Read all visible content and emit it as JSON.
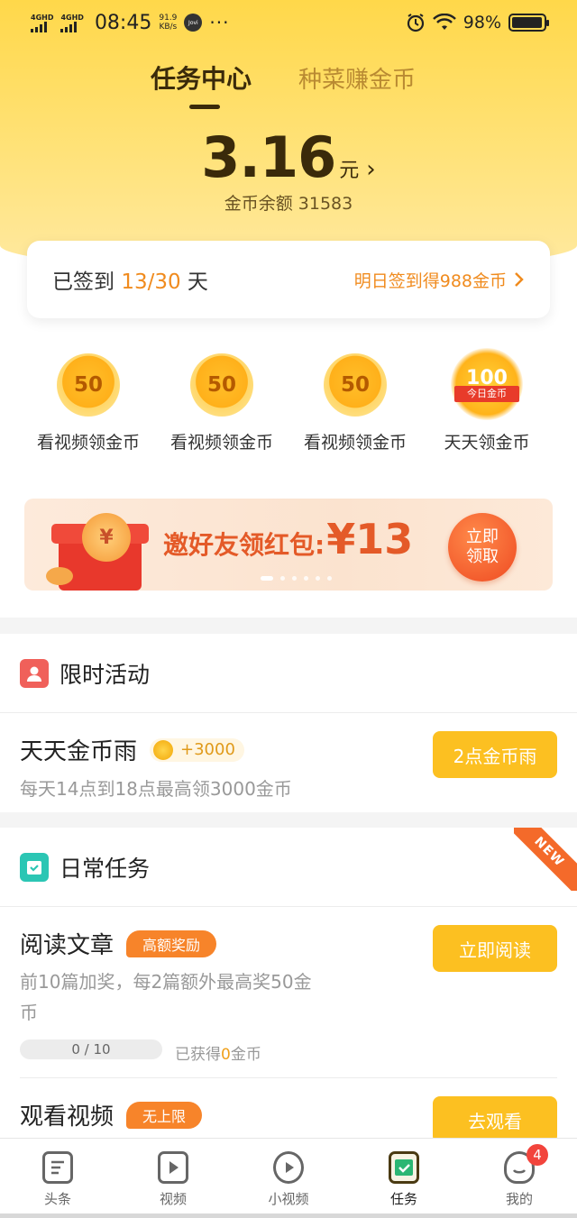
{
  "status_bar": {
    "sim1": "4GHD",
    "sim2": "4GHD",
    "time": "08:45",
    "speed_value": "91.9",
    "speed_unit": "KB/s",
    "app_icon_text": "Jovi",
    "more": "···",
    "battery": "98%"
  },
  "tabs": {
    "active": "任务中心",
    "other": "种菜赚金币"
  },
  "balance": {
    "amount": "3.16",
    "unit": "元",
    "coins_label": "金币余额 31583"
  },
  "signin": {
    "prefix": "已签到",
    "progress": "13/30",
    "suffix": "天",
    "tomorrow": "明日签到得988金币"
  },
  "quick_tasks": [
    {
      "coin": "50",
      "label": "看视频领金币"
    },
    {
      "coin": "50",
      "label": "看视频领金币"
    },
    {
      "coin": "50",
      "label": "看视频领金币"
    },
    {
      "coin": "100",
      "ribbon": "今日金币",
      "label": "天天领金币"
    }
  ],
  "banner": {
    "coin_symbol": "¥",
    "text": "邀好友领红包:",
    "amount": "¥13",
    "button_line1": "立即",
    "button_line2": "领取"
  },
  "limited": {
    "title": "限时活动",
    "item": {
      "title": "天天金币雨",
      "reward": "+3000",
      "desc": "每天14点到18点最高领3000金币",
      "button": "2点金币雨"
    }
  },
  "daily": {
    "title": "日常任务",
    "corner_tag": "NEW",
    "items": [
      {
        "title": "阅读文章",
        "badge": "高额奖励",
        "desc_line1": "前10篇加奖，每2篇额外最高奖50金",
        "desc_line2": "币",
        "progress": "0 / 10",
        "earned_prefix": "已获得",
        "earned_value": "0",
        "earned_suffix": "金币",
        "button": "立即阅读"
      },
      {
        "title": "观看视频",
        "badge": "无上限",
        "button": "去观看"
      }
    ]
  },
  "bottom_nav": {
    "items": [
      {
        "label": "头条",
        "icon": "news-icon"
      },
      {
        "label": "视频",
        "icon": "video-icon"
      },
      {
        "label": "小视频",
        "icon": "short-video-icon"
      },
      {
        "label": "任务",
        "icon": "task-icon",
        "active": true
      },
      {
        "label": "我的",
        "icon": "profile-icon",
        "badge": "4"
      }
    ]
  },
  "colors": {
    "header_yellow": "#ffd84a",
    "accent_orange": "#f08b1e",
    "button_yellow": "#fcc021",
    "badge_orange": "#f7842a"
  }
}
